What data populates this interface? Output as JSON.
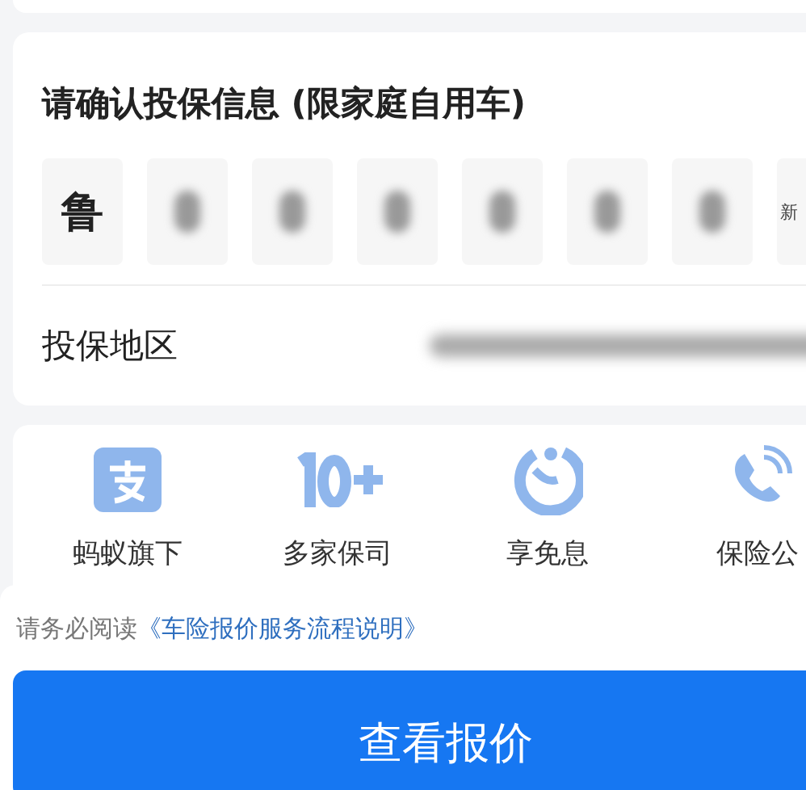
{
  "info_card": {
    "title": "请确认投保信息 (限家庭自用车)",
    "plate": {
      "province": "鲁",
      "new_energy_label": "新"
    },
    "region": {
      "label": "投保地区"
    }
  },
  "features": [
    {
      "label": "蚂蚁旗下",
      "kind": "alipay"
    },
    {
      "label": "多家保司",
      "kind": "count"
    },
    {
      "label": "享免息",
      "kind": "badge"
    },
    {
      "label": "保险公",
      "kind": "phone"
    }
  ],
  "notice": {
    "text": "请务必阅读",
    "link": "《车险报价服务流程说明》"
  },
  "quote_button": {
    "label": "查看报价"
  }
}
